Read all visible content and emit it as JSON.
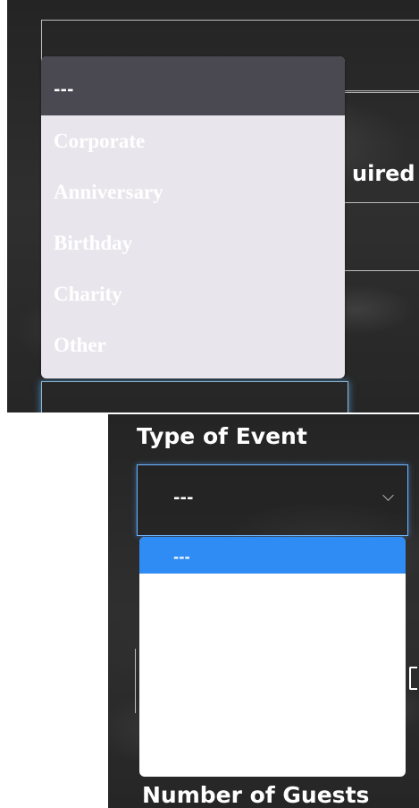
{
  "top_dropdown": {
    "options": [
      {
        "label": "---",
        "selected": true
      },
      {
        "label": "Corporate",
        "selected": false
      },
      {
        "label": "Anniversary",
        "selected": false
      },
      {
        "label": "Birthday",
        "selected": false
      },
      {
        "label": "Charity",
        "selected": false
      },
      {
        "label": "Other",
        "selected": false
      }
    ],
    "partial_label": "uired"
  },
  "bottom_form": {
    "type_label": "Type of Event",
    "select_value": "---",
    "options": [
      {
        "label": "---",
        "selected": true
      }
    ],
    "guests_label": "Number of Guests"
  },
  "colors": {
    "background": "#2b2b2b",
    "selected_top": "#4a4850",
    "list_top_bg": "#e8e6ec",
    "selected_bottom": "#2f8cf5",
    "focus_border": "#6eb5ff"
  },
  "icons": {
    "select_chevron": "chevron-down-icon"
  }
}
